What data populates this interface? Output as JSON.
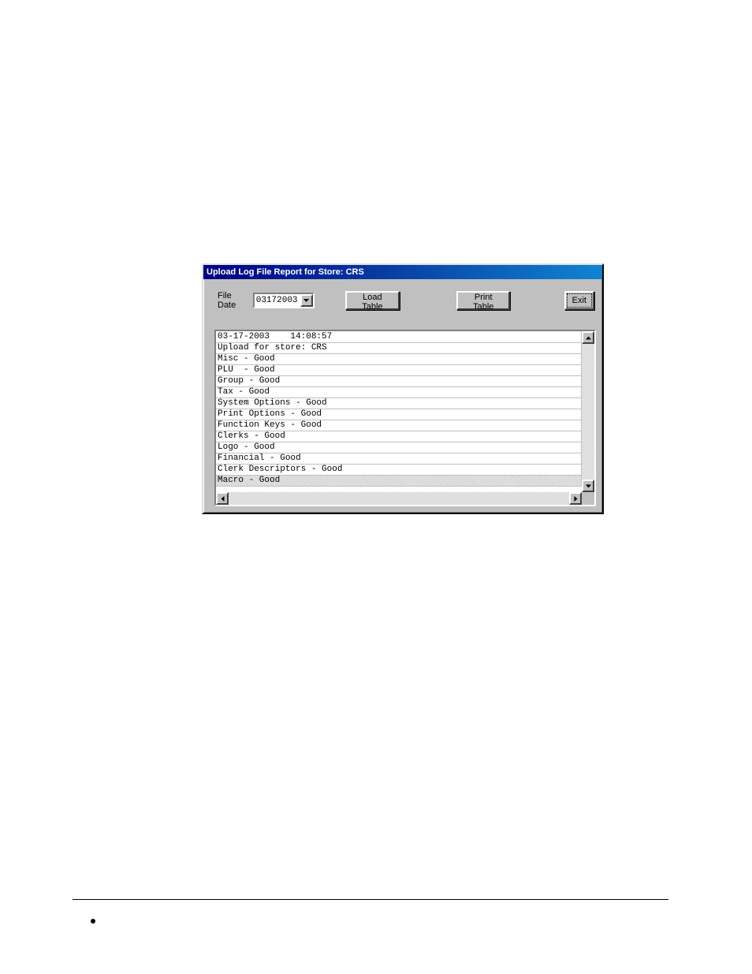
{
  "window": {
    "title": "Upload Log File Report for Store:  CRS"
  },
  "toolbar": {
    "file_date_label": "File Date",
    "file_date_value": "03172003",
    "load_table_label": "Load Table",
    "print_table_label": "Print Table",
    "exit_label": "Exit"
  },
  "log": {
    "rows": [
      {
        "text": "03-17-2003    14:08:57",
        "selected": false
      },
      {
        "text": "Upload for store: CRS",
        "selected": false
      },
      {
        "text": "Misc - Good",
        "selected": false
      },
      {
        "text": "PLU  - Good",
        "selected": false
      },
      {
        "text": "Group - Good",
        "selected": false
      },
      {
        "text": "Tax - Good",
        "selected": false
      },
      {
        "text": "System Options - Good",
        "selected": false
      },
      {
        "text": "Print Options - Good",
        "selected": false
      },
      {
        "text": "Function Keys - Good",
        "selected": false
      },
      {
        "text": "Clerks - Good",
        "selected": false
      },
      {
        "text": "Logo - Good",
        "selected": false
      },
      {
        "text": "Financial - Good",
        "selected": false
      },
      {
        "text": "Clerk Descriptors - Good",
        "selected": false
      },
      {
        "text": "Macro - Good",
        "selected": true
      }
    ]
  }
}
